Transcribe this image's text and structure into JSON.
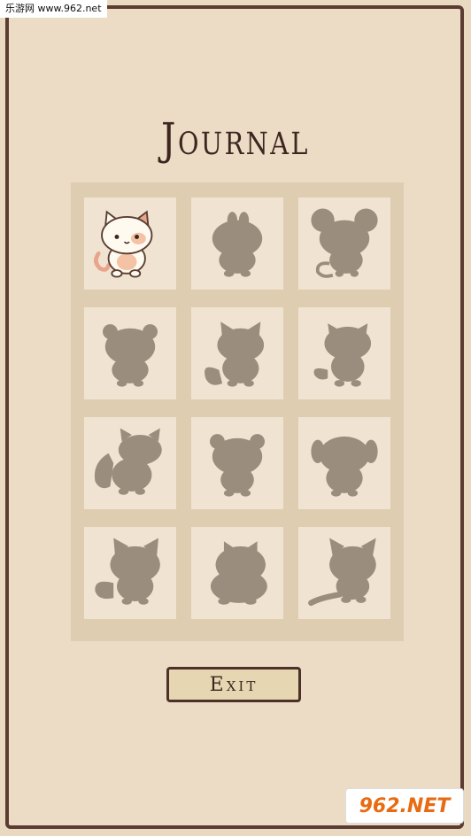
{
  "watermark": {
    "text": "乐游网 www.962.net"
  },
  "title": "Journal",
  "journal": {
    "entries": [
      {
        "icon": "calico-cat-icon",
        "unlocked": true
      },
      {
        "icon": "locked-silhouette-icon",
        "unlocked": false
      },
      {
        "icon": "locked-silhouette-icon",
        "unlocked": false
      },
      {
        "icon": "locked-silhouette-icon",
        "unlocked": false
      },
      {
        "icon": "locked-silhouette-icon",
        "unlocked": false
      },
      {
        "icon": "locked-silhouette-icon",
        "unlocked": false
      },
      {
        "icon": "locked-silhouette-icon",
        "unlocked": false
      },
      {
        "icon": "locked-silhouette-icon",
        "unlocked": false
      },
      {
        "icon": "locked-silhouette-icon",
        "unlocked": false
      },
      {
        "icon": "locked-silhouette-icon",
        "unlocked": false
      },
      {
        "icon": "locked-silhouette-icon",
        "unlocked": false
      },
      {
        "icon": "locked-silhouette-icon",
        "unlocked": false
      }
    ]
  },
  "exit_label": "Exit",
  "logo": {
    "text": "962.NET"
  },
  "colors": {
    "background": "#ecdcc5",
    "frame": "#5b3c32",
    "silhouette": "#9a8d7d",
    "cell": "#f0e3d1",
    "panel": "#dfcdb2"
  }
}
